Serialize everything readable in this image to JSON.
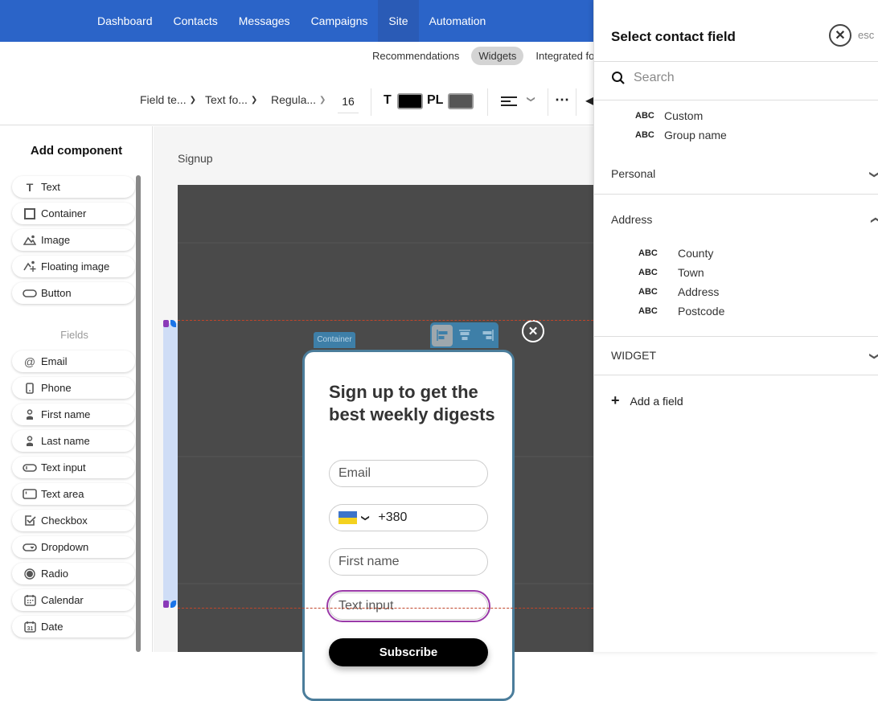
{
  "topnav": {
    "items": [
      {
        "label": "Dashboard",
        "active": false
      },
      {
        "label": "Contacts",
        "active": false
      },
      {
        "label": "Messages",
        "active": false
      },
      {
        "label": "Campaigns",
        "active": false
      },
      {
        "label": "Site",
        "active": true
      },
      {
        "label": "Automation",
        "active": false
      }
    ],
    "color": "#2b64c8"
  },
  "subtabs": [
    {
      "label": "Recommendations",
      "active": false
    },
    {
      "label": "Widgets",
      "active": true
    },
    {
      "label": "Integrated fo",
      "active": false
    }
  ],
  "toolbar": {
    "field_type": "Field te...",
    "text_format": "Text fo...",
    "font_weight": "Regula...",
    "font_size": "16",
    "text_color_label": "T",
    "text_color": "#000000",
    "placeholder_color_label": "PL",
    "placeholder_color": "#555555",
    "align_icon": "align-left-icon",
    "more_icon": "more-icon"
  },
  "left_panel": {
    "title": "Add component",
    "components": [
      {
        "label": "Text",
        "icon": "text-icon"
      },
      {
        "label": "Container",
        "icon": "container-icon"
      },
      {
        "label": "Image",
        "icon": "image-icon"
      },
      {
        "label": "Floating image",
        "icon": "floating-image-icon"
      },
      {
        "label": "Button",
        "icon": "button-icon"
      }
    ],
    "fields_label": "Fields",
    "fields": [
      {
        "label": "Email",
        "icon": "at-icon"
      },
      {
        "label": "Phone",
        "icon": "phone-icon"
      },
      {
        "label": "First name",
        "icon": "person-icon"
      },
      {
        "label": "Last name",
        "icon": "person-icon"
      },
      {
        "label": "Text input",
        "icon": "text-input-icon"
      },
      {
        "label": "Text area",
        "icon": "text-area-icon"
      },
      {
        "label": "Checkbox",
        "icon": "checkbox-icon"
      },
      {
        "label": "Dropdown",
        "icon": "dropdown-icon"
      },
      {
        "label": "Radio",
        "icon": "radio-icon"
      },
      {
        "label": "Calendar",
        "icon": "calendar-icon"
      },
      {
        "label": "Date",
        "icon": "date-icon"
      }
    ]
  },
  "canvas": {
    "page_label": "Signup",
    "container_tag": "Container",
    "widget": {
      "heading": "Sign up to get the best weekly digests",
      "email_placeholder": "Email",
      "phone_code": "+380",
      "first_name_placeholder": "First name",
      "text_input_placeholder": "Text input",
      "subscribe_label": "Subscribe"
    }
  },
  "right_panel": {
    "title": "Select contact field",
    "esc_label": "esc",
    "search_placeholder": "Search",
    "top_fields": [
      {
        "type": "ABC",
        "label": "Custom"
      },
      {
        "type": "ABC",
        "label": "Group name"
      }
    ],
    "sections": [
      {
        "label": "Personal",
        "expanded": false
      },
      {
        "label": "Address",
        "expanded": true,
        "fields": [
          {
            "type": "ABC",
            "label": "County"
          },
          {
            "type": "ABC",
            "label": "Town"
          },
          {
            "type": "ABC",
            "label": "Address"
          },
          {
            "type": "ABC",
            "label": "Postcode"
          }
        ]
      },
      {
        "label": "WIDGET",
        "expanded": false
      }
    ],
    "add_field_label": "Add a field"
  }
}
